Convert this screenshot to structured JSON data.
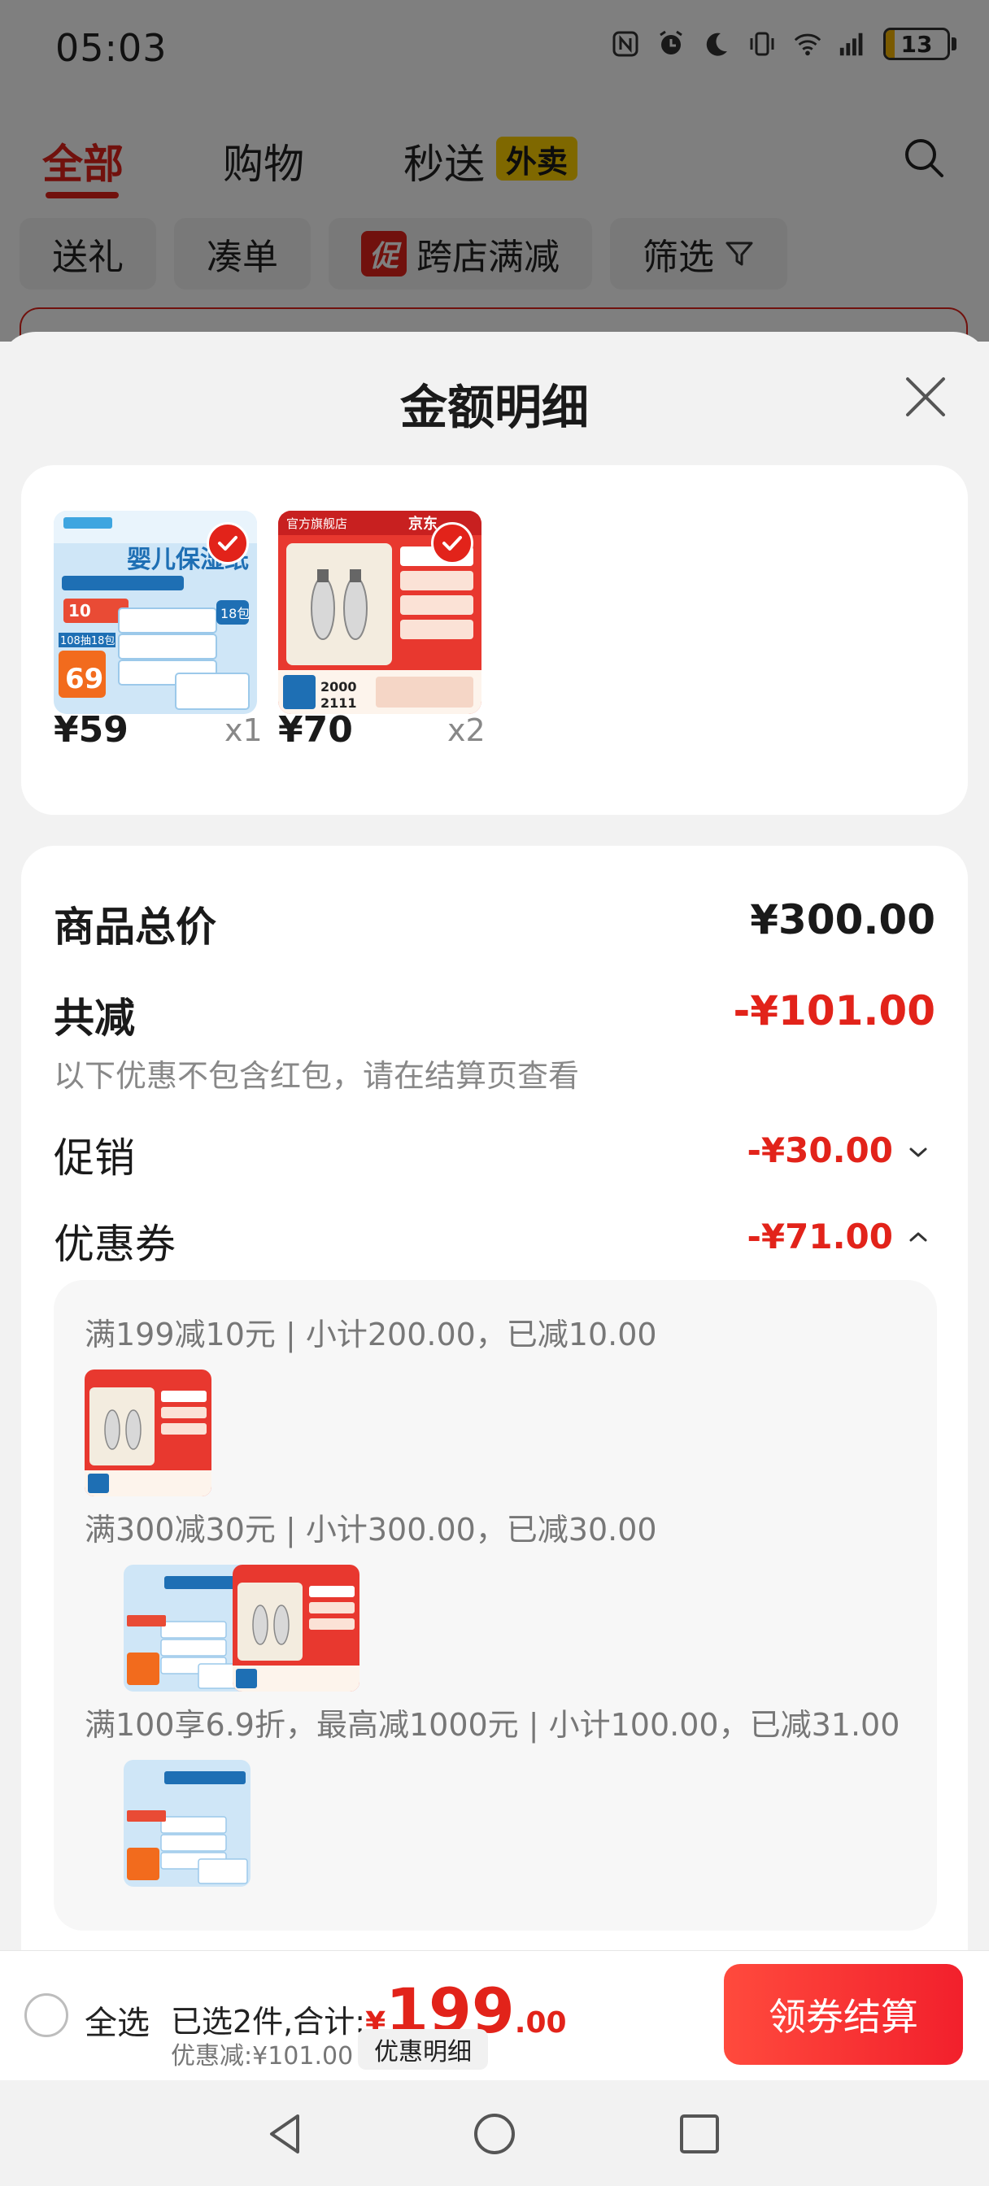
{
  "status_bar": {
    "time": "05:03",
    "battery_level": "13",
    "icons": [
      "nfc-icon",
      "alarm-icon",
      "moon-icon",
      "vibrate-icon",
      "wifi-icon",
      "signal-icon",
      "battery-icon"
    ]
  },
  "top_tabs": {
    "items": [
      "全部",
      "购物",
      "秒送"
    ],
    "active": "全部",
    "takeout_badge": "外卖"
  },
  "filters": {
    "gift": "送礼",
    "bundle": "凑单",
    "promo_tag": "促",
    "cross_store": "跨店满减",
    "filter": "筛选"
  },
  "sheet": {
    "title": "金额明细",
    "items": [
      {
        "price": "¥59",
        "qty": "x1"
      },
      {
        "price": "¥70",
        "qty": "x2"
      }
    ],
    "total_label": "商品总价",
    "total_value": "¥300.00",
    "reduce_label": "共减",
    "reduce_value": "-¥101.00",
    "reduce_note": "以下优惠不包含红包，请在结算页查看",
    "promo_label": "促销",
    "promo_value": "-¥30.00",
    "coupon_label": "优惠券",
    "coupon_value": "-¥71.00",
    "coupon_rules": [
      "满199减10元 | 小计200.00，已减10.00",
      "满300减30元 | 小计300.00，已减30.00",
      "满100享6.9折，最高减1000元 | 小计100.00，已减31.00"
    ]
  },
  "product_art": {
    "tissue_title": "婴儿保湿纸",
    "tissue_price": "69",
    "tissue_count": "18包",
    "tissue_promo": "108抽18包",
    "wine_store": "官方旗舰店",
    "wine_brand": "京东",
    "wine_price_a": "2000",
    "wine_price_b": "2111"
  },
  "bottom_bar": {
    "select_all": "全选",
    "selected_text": "已选2件,合计:",
    "currency": "¥",
    "total_int": "199",
    "total_dec": ".00",
    "discount_text": "优惠减:¥101.00",
    "detail_button": "优惠明细",
    "checkout_button": "领券结算"
  },
  "colors": {
    "accent_red": "#e2231a",
    "takeout_yellow": "#ffd100",
    "battery_yellow": "#f4b400"
  }
}
